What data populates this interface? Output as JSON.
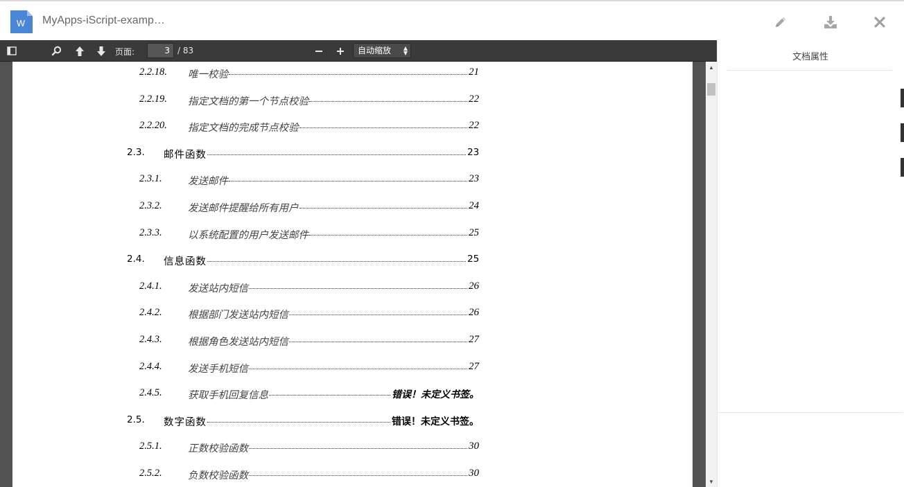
{
  "header": {
    "file_badge": "W",
    "file_icon": "word-document-icon",
    "accent_color": "#4a86d8",
    "title": "MyApps-iScript-examp…",
    "actions": [
      {
        "name": "edit-icon"
      },
      {
        "name": "download-icon"
      },
      {
        "name": "close-icon"
      }
    ]
  },
  "toolbar": {
    "page_label": "页面:",
    "current_page": "3",
    "total_pages": "/ 83",
    "zoom_value": "自动缩放",
    "icons": [
      "sidebar-toggle-icon",
      "search-icon",
      "previous-page-icon",
      "next-page-icon",
      "zoom-out-icon",
      "zoom-in-icon"
    ]
  },
  "toc": [
    {
      "level": 3,
      "num": "2.2.18.",
      "text": "唯一校验",
      "page": "21",
      "error": false
    },
    {
      "level": 3,
      "num": "2.2.19.",
      "text": "指定文档的第一个节点校验",
      "page": "22",
      "error": false
    },
    {
      "level": 3,
      "num": "2.2.20.",
      "text": "指定文档的完成节点校验",
      "page": "22",
      "error": false
    },
    {
      "level": 2,
      "num": "2.3.",
      "text": "邮件函数",
      "page": "23",
      "error": false
    },
    {
      "level": 3,
      "num": "2.3.1.",
      "text": "发送邮件",
      "page": "23",
      "error": false
    },
    {
      "level": 3,
      "num": "2.3.2.",
      "text": "发送邮件提醒给所有用户",
      "page": "24",
      "error": false
    },
    {
      "level": 3,
      "num": "2.3.3.",
      "text": "以系统配置的用户发送邮件",
      "page": "25",
      "error": false
    },
    {
      "level": 2,
      "num": "2.4.",
      "text": "信息函数",
      "page": "25",
      "error": false
    },
    {
      "level": 3,
      "num": "2.4.1.",
      "text": "发送站内短信",
      "page": "26",
      "error": false
    },
    {
      "level": 3,
      "num": "2.4.2.",
      "text": "根据部门发送站内短信",
      "page": "26",
      "error": false
    },
    {
      "level": 3,
      "num": "2.4.3.",
      "text": "根据角色发送站内短信",
      "page": "27",
      "error": false
    },
    {
      "level": 3,
      "num": "2.4.4.",
      "text": "发送手机短信",
      "page": "27",
      "error": false
    },
    {
      "level": 3,
      "num": "2.4.5.",
      "text": "获取手机回复信息",
      "page": "错误！未定义书签。",
      "error": true
    },
    {
      "level": 2,
      "num": "2.5.",
      "text": "数字函数",
      "page": "错误！未定义书签。",
      "error": true
    },
    {
      "level": 3,
      "num": "2.5.1.",
      "text": "正数校验函数",
      "page": "30",
      "error": false
    },
    {
      "level": 3,
      "num": "2.5.2.",
      "text": "负数校验函数",
      "page": "30",
      "error": false
    }
  ],
  "side_panel": {
    "title": "文档属性"
  }
}
